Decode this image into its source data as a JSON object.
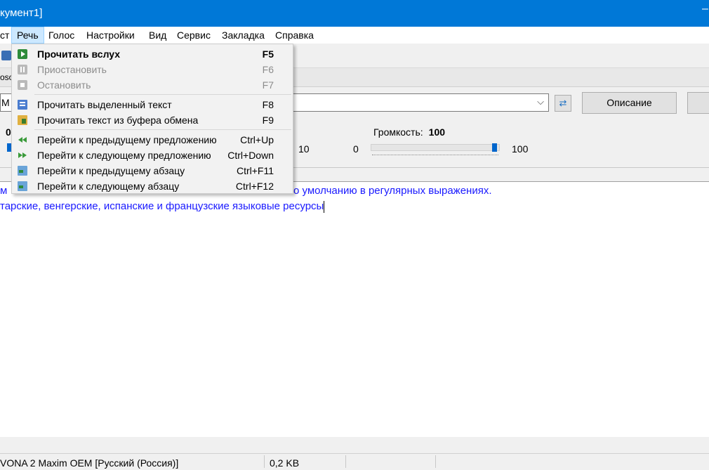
{
  "window": {
    "title": "кумент1]",
    "min_glyph": "–"
  },
  "menubar": [
    {
      "label": "ст"
    },
    {
      "label": "Речь",
      "active": true
    },
    {
      "label": "Голос"
    },
    {
      "label": "Настройки"
    },
    {
      "label": "Вид"
    },
    {
      "label": "Сервис"
    },
    {
      "label": "Закладка"
    },
    {
      "label": "Справка"
    }
  ],
  "infostrip": {
    "text": "oso"
  },
  "voice_combo": {
    "prefix": "M",
    "arrow": "⌵"
  },
  "buttons": {
    "swap_icon": "⇄",
    "description": "Описание",
    "cut_label": ""
  },
  "sliders": {
    "left_value": "0",
    "left_max": "10",
    "volume_label": "Громкость:",
    "volume_value": "100",
    "volume_min": "0",
    "volume_max": "100",
    "volume_level_percent": 100
  },
  "editor": {
    "line1_prefix": "м",
    "line1": "о умолчанию в регулярных выражениях.",
    "line2": "тарские, венгерские, испанские и французские языковые ресурсы"
  },
  "dropdown": {
    "items": [
      {
        "label": "Прочитать вслух",
        "shortcut": "F5",
        "icon": "play-icon",
        "bold": true
      },
      {
        "label": "Приостановить",
        "shortcut": "F6",
        "icon": "pause-icon",
        "disabled": true
      },
      {
        "label": "Остановить",
        "shortcut": "F7",
        "icon": "stop-icon",
        "disabled": true
      },
      {
        "label": "Прочитать выделенный текст",
        "shortcut": "F8",
        "icon": "read-selection-icon"
      },
      {
        "label": "Прочитать текст из буфера обмена",
        "shortcut": "F9",
        "icon": "clipboard-icon"
      },
      {
        "label": "Перейти к предыдущему предложению",
        "shortcut": "Ctrl+Up",
        "icon": "prev-sentence-icon"
      },
      {
        "label": "Перейти к следующему предложению",
        "shortcut": "Ctrl+Down",
        "icon": "next-sentence-icon"
      },
      {
        "label": "Перейти к предыдущему абзацу",
        "shortcut": "Ctrl+F11",
        "icon": "prev-paragraph-icon"
      },
      {
        "label": "Перейти к следующему абзацу",
        "shortcut": "Ctrl+F12",
        "icon": "next-paragraph-icon"
      }
    ]
  },
  "statusbar": {
    "voice": "VONA 2 Maxim OEM [Русский (Россия)]",
    "size": "0,2 KB"
  },
  "colors": {
    "titlebar": "#0078d7",
    "editor_text": "#1a1aff",
    "menu_active": "#cce8ff"
  }
}
